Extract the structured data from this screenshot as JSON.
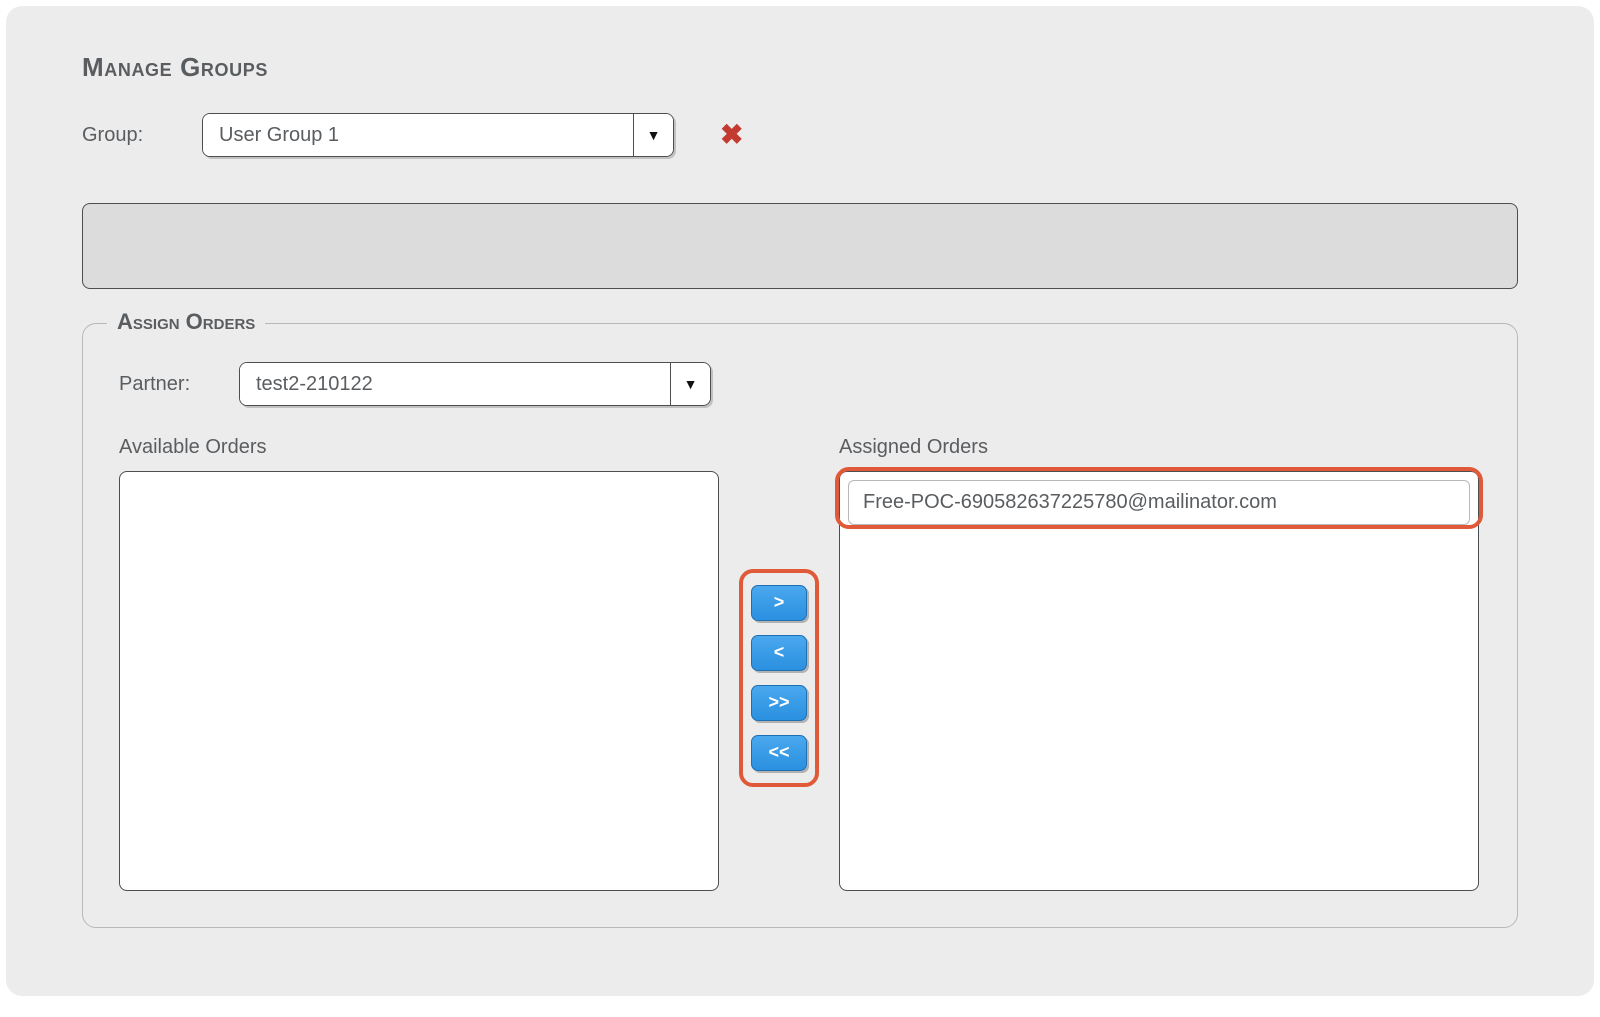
{
  "page": {
    "title": "Manage Groups"
  },
  "fields": {
    "group_label": "Group:",
    "group_value": "User Group 1"
  },
  "assign": {
    "legend": "Assign Orders",
    "partner_label": "Partner:",
    "partner_value": "test2-210122",
    "available_title": "Available Orders",
    "assigned_title": "Assigned Orders",
    "available_items": [],
    "assigned_items": [
      "Free-POC-690582637225780@mailinator.com"
    ]
  },
  "buttons": {
    "move_right": ">",
    "move_left": "<",
    "move_all_right": ">>",
    "move_all_left": "<<"
  },
  "icons": {
    "delete": "✖",
    "dropdown": "▼"
  }
}
